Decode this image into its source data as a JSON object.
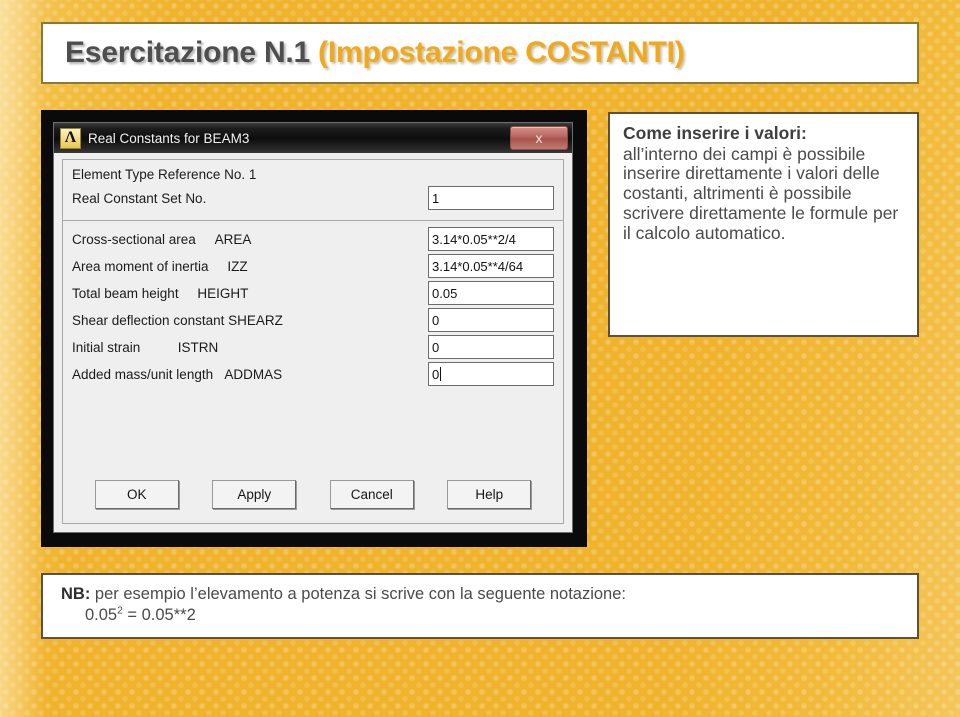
{
  "slide": {
    "background_color": "#f0b32d",
    "title": {
      "main": "Esercitazione N.1",
      "sub": "(Impostazione COSTANTI)"
    }
  },
  "dialog": {
    "logo_glyph": "Λ",
    "title": "Real Constants for BEAM3",
    "close_label": "x",
    "header_line": "Element Type Reference No. 1",
    "set_row": {
      "label": "Real Constant Set No.",
      "value": "1"
    },
    "fields": [
      {
        "label": "Cross-sectional area",
        "code": "AREA",
        "value": "3.14*0.05**2/4",
        "caret": false
      },
      {
        "label": "Area moment of inertia",
        "code": "IZZ",
        "value": "3.14*0.05**4/64",
        "caret": false
      },
      {
        "label": "Total beam height",
        "code": "HEIGHT",
        "value": "0.05",
        "caret": false
      },
      {
        "label": "Shear deflection constant",
        "code": "SHEARZ",
        "value": "0",
        "caret": false
      },
      {
        "label": "Initial strain",
        "code": "ISTRN",
        "value": "0",
        "caret": false
      },
      {
        "label": "Added mass/unit length",
        "code": "ADDMAS",
        "value": "0",
        "caret": true
      }
    ],
    "buttons": [
      {
        "label": "OK"
      },
      {
        "label": "Apply"
      },
      {
        "label": "Cancel"
      },
      {
        "label": "Help"
      }
    ]
  },
  "note": {
    "heading": "Come inserire i valori:",
    "body": "all’interno dei campi è possibile inserire direttamente i valori delle costanti, altrimenti è possibile scrivere direttamente le formule per il calcolo automatico."
  },
  "nb": {
    "prefix": "NB:",
    "text": "per esempio l’elevamento a potenza si scrive con la seguente notazione:",
    "formula_base": "0.05",
    "formula_exponent": "2",
    "formula_rest": " = 0.05**2"
  }
}
